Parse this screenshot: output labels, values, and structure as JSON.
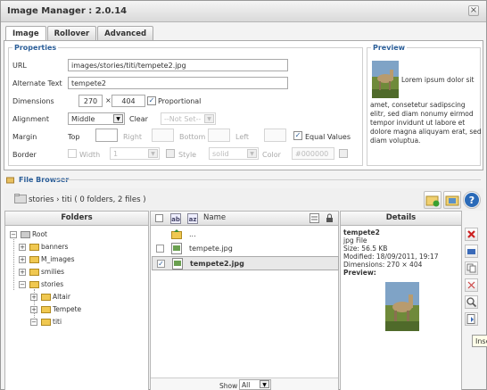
{
  "window": {
    "title": "Image Manager : 2.0.14",
    "close_glyph": "×"
  },
  "tabs": [
    {
      "label": "Image",
      "active": true
    },
    {
      "label": "Rollover",
      "active": false
    },
    {
      "label": "Advanced",
      "active": false
    }
  ],
  "properties": {
    "legend": "Properties",
    "url_label": "URL",
    "url_value": "images/stories/titi/tempete2.jpg",
    "alt_label": "Alternate Text",
    "alt_value": "tempete2",
    "dimensions_label": "Dimensions",
    "width": "270",
    "times": "×",
    "height": "404",
    "proportional_label": "Proportional",
    "proportional_checked": true,
    "alignment_label": "Alignment",
    "alignment_value": "Middle",
    "clear_label": "Clear",
    "clear_value": "--Not Set--",
    "margin_label": "Margin",
    "top_label": "Top",
    "right_label": "Right",
    "bottom_label": "Bottom",
    "left_label": "Left",
    "equal_values_label": "Equal Values",
    "equal_values_checked": true,
    "border_label": "Border",
    "border_width_label": "Width",
    "border_width_value": "1",
    "border_style_label": "Style",
    "border_style_value": "solid",
    "border_color_label": "Color",
    "border_color_value": "#000000"
  },
  "preview": {
    "legend": "Preview",
    "text_side": "Lorem ipsum dolor sit",
    "text_rest": "amet, consetetur sadipscing elitr, sed diam nonumy eirmod tempor invidunt ut labore et dolore magna aliquyam erat, sed diam voluptua."
  },
  "file_browser": {
    "legend": "File Browser",
    "path": "stories › titi",
    "path_info": " ( 0 folders, 2 files )",
    "folders_header": "Folders",
    "name_header": "Name",
    "details_header": "Details",
    "tree": [
      {
        "label": "Root",
        "toggle": "⊟"
      },
      {
        "label": "banners",
        "toggle": "+"
      },
      {
        "label": "M_images",
        "toggle": "+"
      },
      {
        "label": "smilies",
        "toggle": "+"
      },
      {
        "label": "stories",
        "toggle": "−"
      },
      {
        "label": "Altair",
        "toggle": "+"
      },
      {
        "label": "Tempete",
        "toggle": "+"
      },
      {
        "label": "titi",
        "toggle": "−"
      }
    ],
    "files": [
      {
        "name": "...",
        "checked": false,
        "is_parent": true
      },
      {
        "name": "tempete.jpg",
        "checked": false,
        "is_parent": false
      },
      {
        "name": "tempete2.jpg",
        "checked": true,
        "is_parent": false
      }
    ],
    "details": {
      "name": "tempete2",
      "type": "jpg File",
      "size": "Size: 56.5 KB",
      "modified": "Modified: 18/09/2011, 19:17",
      "dimensions": "Dimensions: 270 × 404",
      "preview_label": "Preview:"
    },
    "show_label": "Show",
    "show_value": "All",
    "tooltip": "Inse"
  },
  "colors": {
    "accent": "#2b5e98",
    "delete": "#cc2222"
  }
}
